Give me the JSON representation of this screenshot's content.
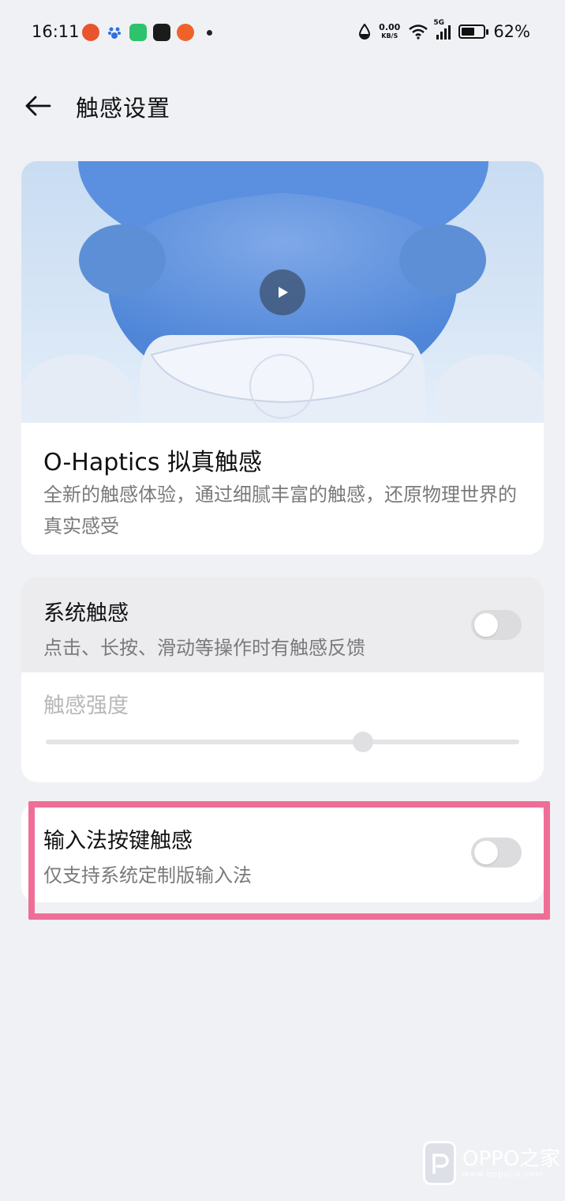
{
  "status_bar": {
    "time": "16:11",
    "net_speed": "0.00",
    "net_unit": "KB/S",
    "network_type": "5G",
    "battery_percent": "62%",
    "battery_level": 0.62,
    "app_icons": [
      "taobao-app-icon",
      "baidu-app-icon",
      "wechat-mini-icon",
      "text-app-icon",
      "orange-app-icon"
    ]
  },
  "header": {
    "back_icon": "arrow-left-icon",
    "title": "触感设置"
  },
  "hero": {
    "play_icon": "play-icon",
    "title": "O-Haptics 拟真触感",
    "description": "全新的触感体验，通过细腻丰富的触感，还原物理世界的真实感受"
  },
  "system_haptics": {
    "title": "系统触感",
    "subtitle": "点击、长按、滑动等操作时有触感反馈",
    "enabled": false,
    "intensity_label": "触感强度",
    "intensity_value": 0.67
  },
  "ime_haptics": {
    "title": "输入法按键触感",
    "subtitle": "仅支持系统定制版输入法",
    "enabled": false
  },
  "watermark": {
    "brand": "OPPO之家",
    "url": "www.oppojia.com"
  },
  "colors": {
    "background": "#f0f1f5",
    "highlight": "#ee6e96",
    "toggle_off": "#dcdcdf"
  }
}
